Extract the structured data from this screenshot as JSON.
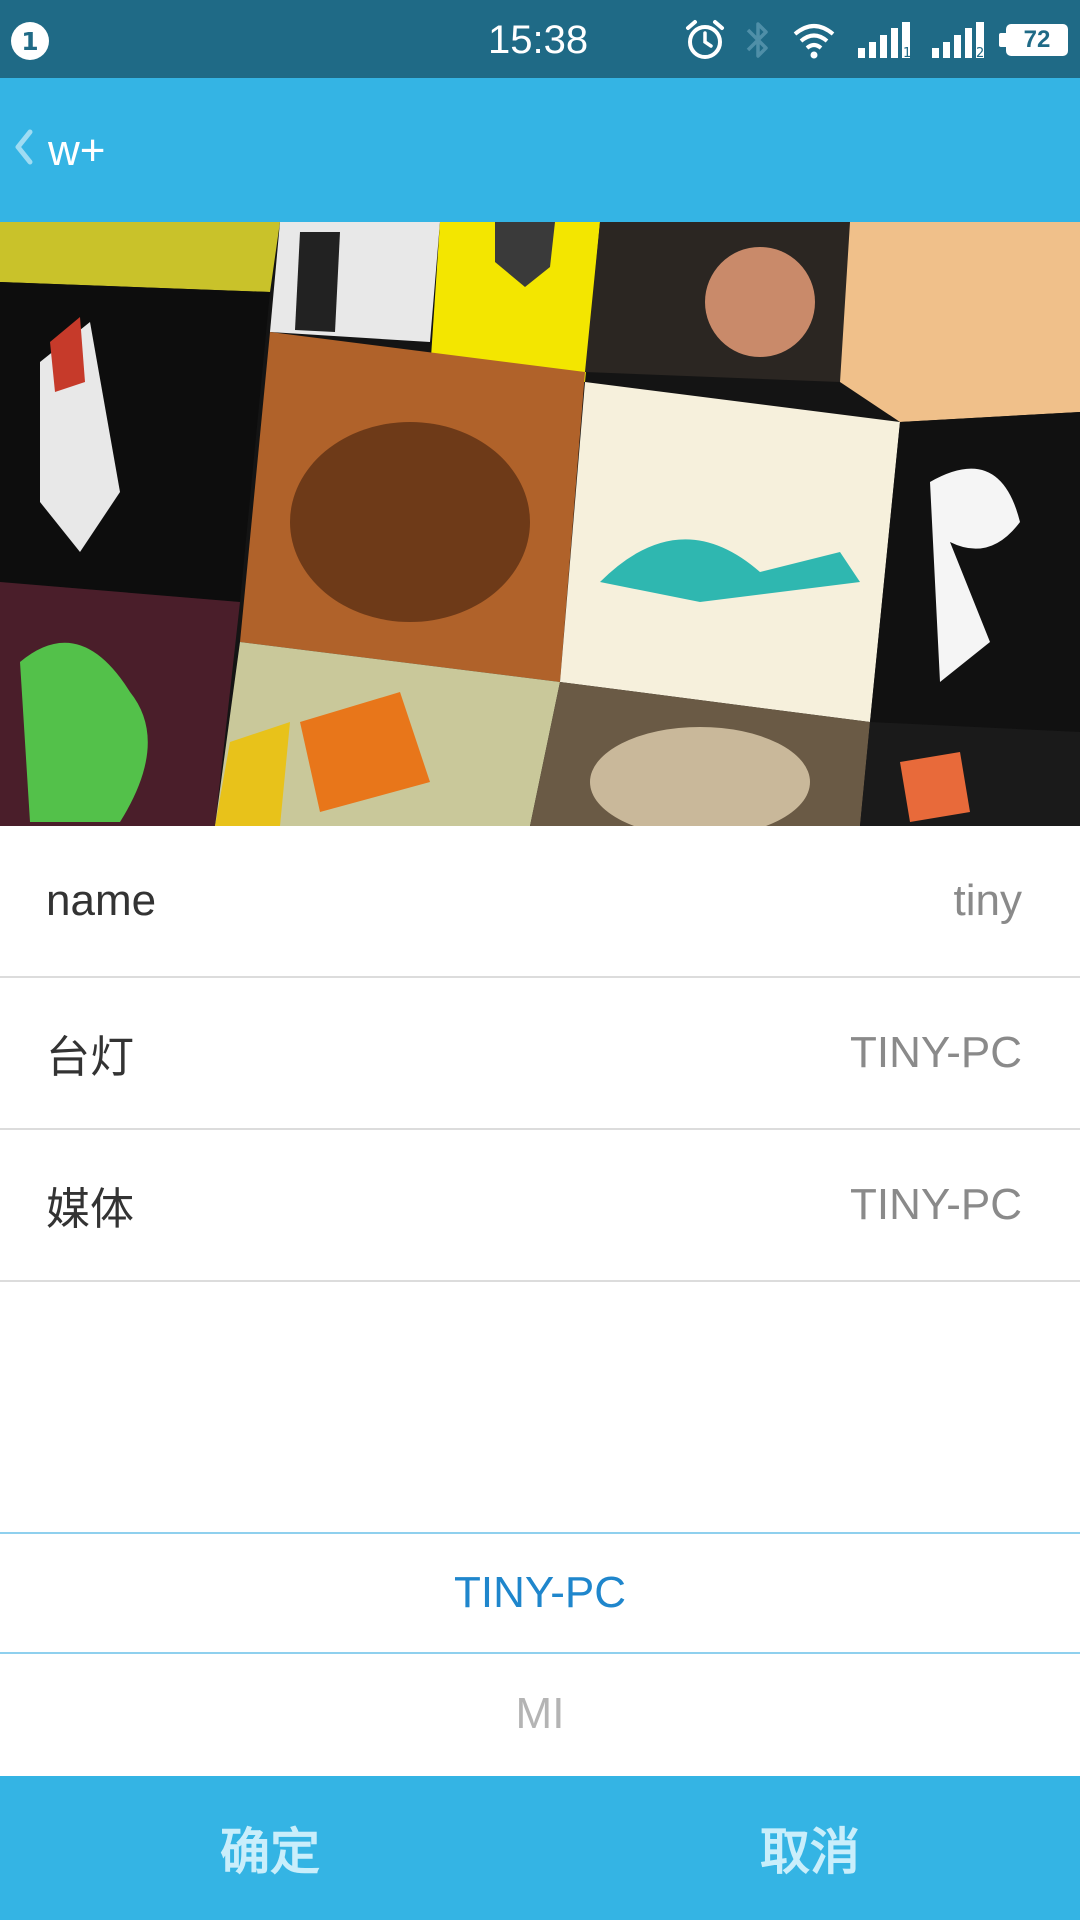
{
  "status_bar": {
    "notification_count": "1",
    "time": "15:38",
    "battery": "72",
    "icons": [
      "alarm-icon",
      "bluetooth-icon",
      "wifi-icon",
      "signal-sim1-icon",
      "signal-sim2-icon",
      "battery-icon"
    ]
  },
  "app_bar": {
    "title": "w+",
    "back_icon": "chevron-left-icon"
  },
  "banner": {
    "alt": "collage"
  },
  "rows": [
    {
      "label": "name",
      "value": "tiny"
    },
    {
      "label": "台灯",
      "value": "TINY-PC"
    },
    {
      "label": "媒体",
      "value": "TINY-PC"
    }
  ],
  "picker": {
    "options": [
      {
        "label": "TINY-PC",
        "selected": true
      },
      {
        "label": "MI",
        "selected": false
      }
    ]
  },
  "bottom_bar": {
    "confirm": "确定",
    "cancel": "取消"
  },
  "colors": {
    "status_bar": "#1f6a86",
    "accent": "#34b4e4",
    "picker_selected": "#1f86cc"
  }
}
